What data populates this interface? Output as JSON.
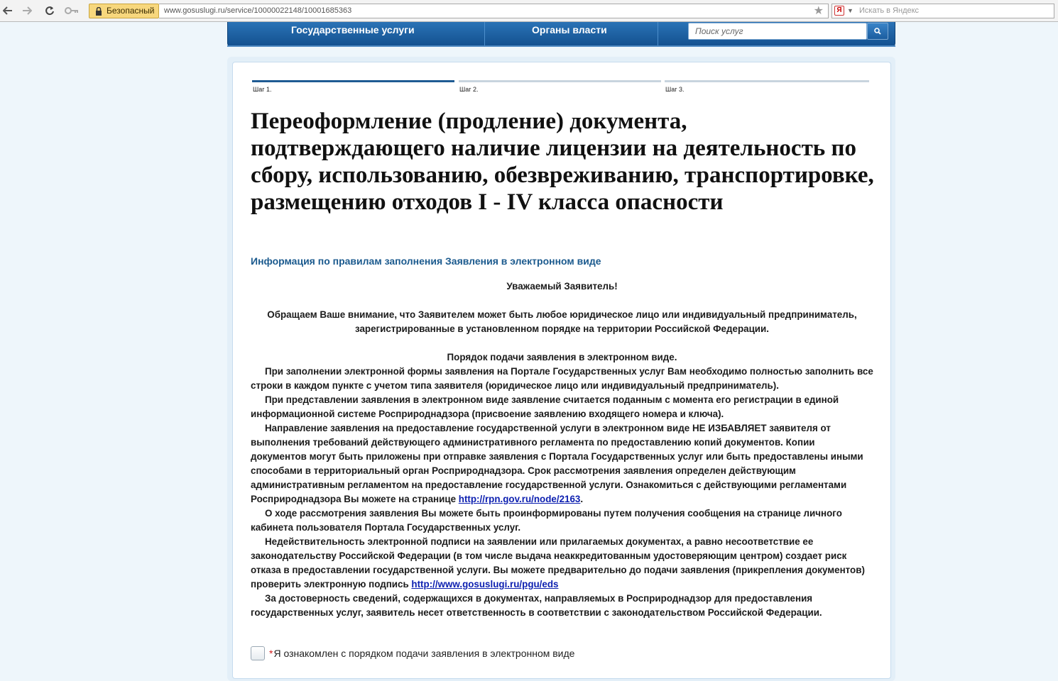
{
  "browser": {
    "security_label": "Безопасный",
    "url": "www.gosuslugi.ru/service/10000022148/10001685363",
    "search_placeholder": "Искать в Яндекс",
    "yandex_logo": "Я"
  },
  "topnav": {
    "items": [
      "Государственные услуги",
      "Органы власти"
    ],
    "search_placeholder": "Поиск услуг"
  },
  "steps": [
    {
      "label": "Шаг 1.",
      "active": true
    },
    {
      "label": "Шаг 2.",
      "active": false
    },
    {
      "label": "Шаг 3.",
      "active": false
    }
  ],
  "page_title": "Переоформление (продление) документа, подтверждающего наличие лицензии на деятельность по сбору, использованию, обезвреживанию, транспортировке, размещению отходов I - IV класса опасности",
  "info_heading": "Информация по правилам заполнения Заявления в электронном виде",
  "notice": {
    "greeting": "Уважаемый Заявитель!",
    "applicant_note": "Обращаем Ваше внимание, что Заявителем может быть любое юридическое лицо или индивидуальный предприниматель, зарегистрированные в установленном порядке на территории Российской Федерации.",
    "procedure_heading": "Порядок подачи заявления в электронном виде.",
    "p1": "При заполнении электронной формы заявления на Портале Государственных услуг Вам необходимо полностью заполнить все строки в каждом пункте с учетом типа заявителя (юридическое лицо или индивидуальный предприниматель).",
    "p2": "При представлении заявления в электронном виде заявление считается поданным с момента его регистрации в единой информационной системе Росприроднадзора (присвоение заявлению входящего номера и ключа).",
    "p3": "Направление заявления на предоставление государственной услуги в электронном виде НЕ ИЗБАВЛЯЕТ заявителя от выполнения требований действующего административного регламента по предоставлению копий документов. Копии документов могут быть приложены при отправке заявления с Портала Государственных услуг или быть предоставлены иными способами в территориальный орган Росприроднадзора. Срок рассмотрения заявления определен действующим административным регламентом на предоставление государственной услуги. Ознакомиться с действующими регламентами Росприроднадзора Вы можете на странице ",
    "p3_link": "http://rpn.gov.ru/node/2163",
    "p3_end": ".",
    "p4": "О ходе рассмотрения заявления Вы можете быть проинформированы путем получения сообщения на странице личного кабинета пользователя Портала Государственных услуг.",
    "p5": "Недействительность электронной подписи на заявлении или прилагаемых документах, а равно несоответствие ее законодательству Российской Федерации (в том числе выдача неаккредитованным удостоверяющим центром) создает риск отказа в предоставлении государственной услуги. Вы можете предварительно до подачи заявления (прикрепления документов) проверить электронную подпись ",
    "p5_link": "http://www.gosuslugi.ru/pgu/eds",
    "p6": "За достоверность сведений, содержащихся в документах, направляемых в Росприроднадзор для предоставления государственных услуг, заявитель несет ответственность в соответствии с законодательством Российской Федерации."
  },
  "agreement": {
    "required_mark": "*",
    "label": "Я ознакомлен с порядком подачи заявления в электронном виде"
  }
}
